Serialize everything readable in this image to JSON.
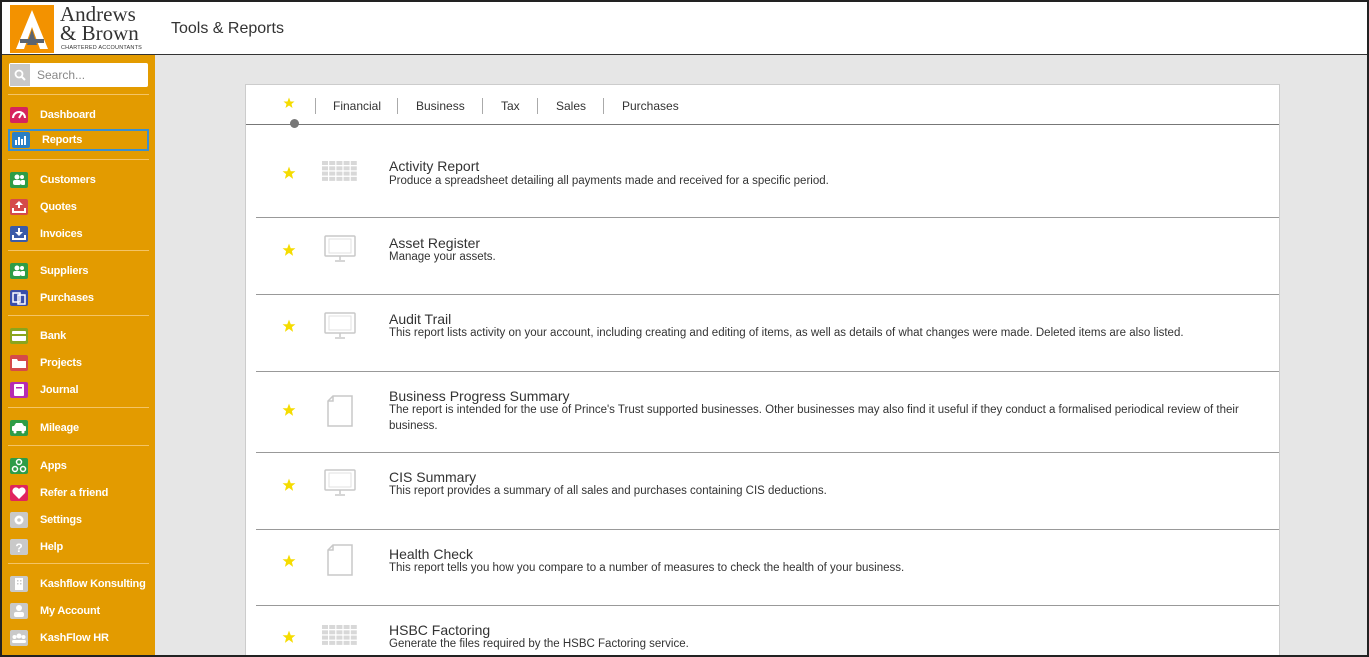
{
  "header": {
    "logo": {
      "line1": "Andrews",
      "line2": "& Brown",
      "tagline": "CHARTERED ACCOUNTANTS"
    },
    "title": "Tools & Reports"
  },
  "sidebar": {
    "search_placeholder": "Search...",
    "items": [
      {
        "label": "Dashboard",
        "icon": "gauge-icon",
        "color": "#d6245d"
      },
      {
        "label": "Reports",
        "icon": "bar-chart-icon",
        "color": "#2a7fc4",
        "active": true
      },
      {
        "label": "Customers",
        "icon": "users-icon",
        "color": "#2e9c46"
      },
      {
        "label": "Quotes",
        "icon": "upload-tray-icon",
        "color": "#d54a4a"
      },
      {
        "label": "Invoices",
        "icon": "download-tray-icon",
        "color": "#3b5ba8"
      },
      {
        "label": "Suppliers",
        "icon": "users-icon",
        "color": "#2e9c46"
      },
      {
        "label": "Purchases",
        "icon": "receipts-icon",
        "color": "#3b4fa8"
      },
      {
        "label": "Bank",
        "icon": "card-icon",
        "color": "#8aa51c"
      },
      {
        "label": "Projects",
        "icon": "folder-icon",
        "color": "#d54a4a"
      },
      {
        "label": "Journal",
        "icon": "book-icon",
        "color": "#b62cb2"
      },
      {
        "label": "Mileage",
        "icon": "car-icon",
        "color": "#2e9c46"
      },
      {
        "label": "Apps",
        "icon": "apps-icon",
        "color": "#2e9c46"
      },
      {
        "label": "Refer a friend",
        "icon": "heart-icon",
        "color": "#e0245e"
      },
      {
        "label": "Settings",
        "icon": "gear-icon",
        "color": "#c9c9c9"
      },
      {
        "label": "Help",
        "icon": "question-icon",
        "color": "#c9c9c9"
      },
      {
        "label": "Kashflow Konsulting",
        "icon": "building-icon",
        "color": "#c9c9c9"
      },
      {
        "label": "My Account",
        "icon": "user-icon",
        "color": "#c9c9c9"
      },
      {
        "label": "KashFlow HR",
        "icon": "team-icon",
        "color": "#c9c9c9"
      }
    ]
  },
  "tabs": [
    "Financial",
    "Business",
    "Tax",
    "Sales",
    "Purchases"
  ],
  "reports": [
    {
      "title": "Activity Report",
      "description": "Produce a spreadsheet detailing all payments made and received for a specific period.",
      "icon": "grid-icon"
    },
    {
      "title": "Asset Register",
      "description": "Manage your assets.",
      "icon": "monitor-icon"
    },
    {
      "title": "Audit Trail",
      "description": "This report lists activity on your account, including creating and editing of items, as well as details of what changes were made. Deleted items are also listed.",
      "icon": "monitor-icon"
    },
    {
      "title": "Business Progress Summary",
      "description": "The report is intended for the use of Prince's Trust supported businesses. Other businesses may also find it useful if they conduct a formalised periodical review of their business.",
      "icon": "document-icon"
    },
    {
      "title": "CIS Summary",
      "description": "This report provides a summary of all sales and purchases containing CIS deductions.",
      "icon": "monitor-icon"
    },
    {
      "title": "Health Check",
      "description": "This report tells you how you compare to a number of measures to check the health of your business.",
      "icon": "document-icon"
    },
    {
      "title": "HSBC Factoring",
      "description": "Generate the files required by the HSBC Factoring service.",
      "icon": "grid-icon"
    }
  ],
  "colors": {
    "sidebar_bg": "#e39b00",
    "logo_orange": "#f39200",
    "star": "#f5dc00",
    "active_border": "#3a8fd0"
  }
}
